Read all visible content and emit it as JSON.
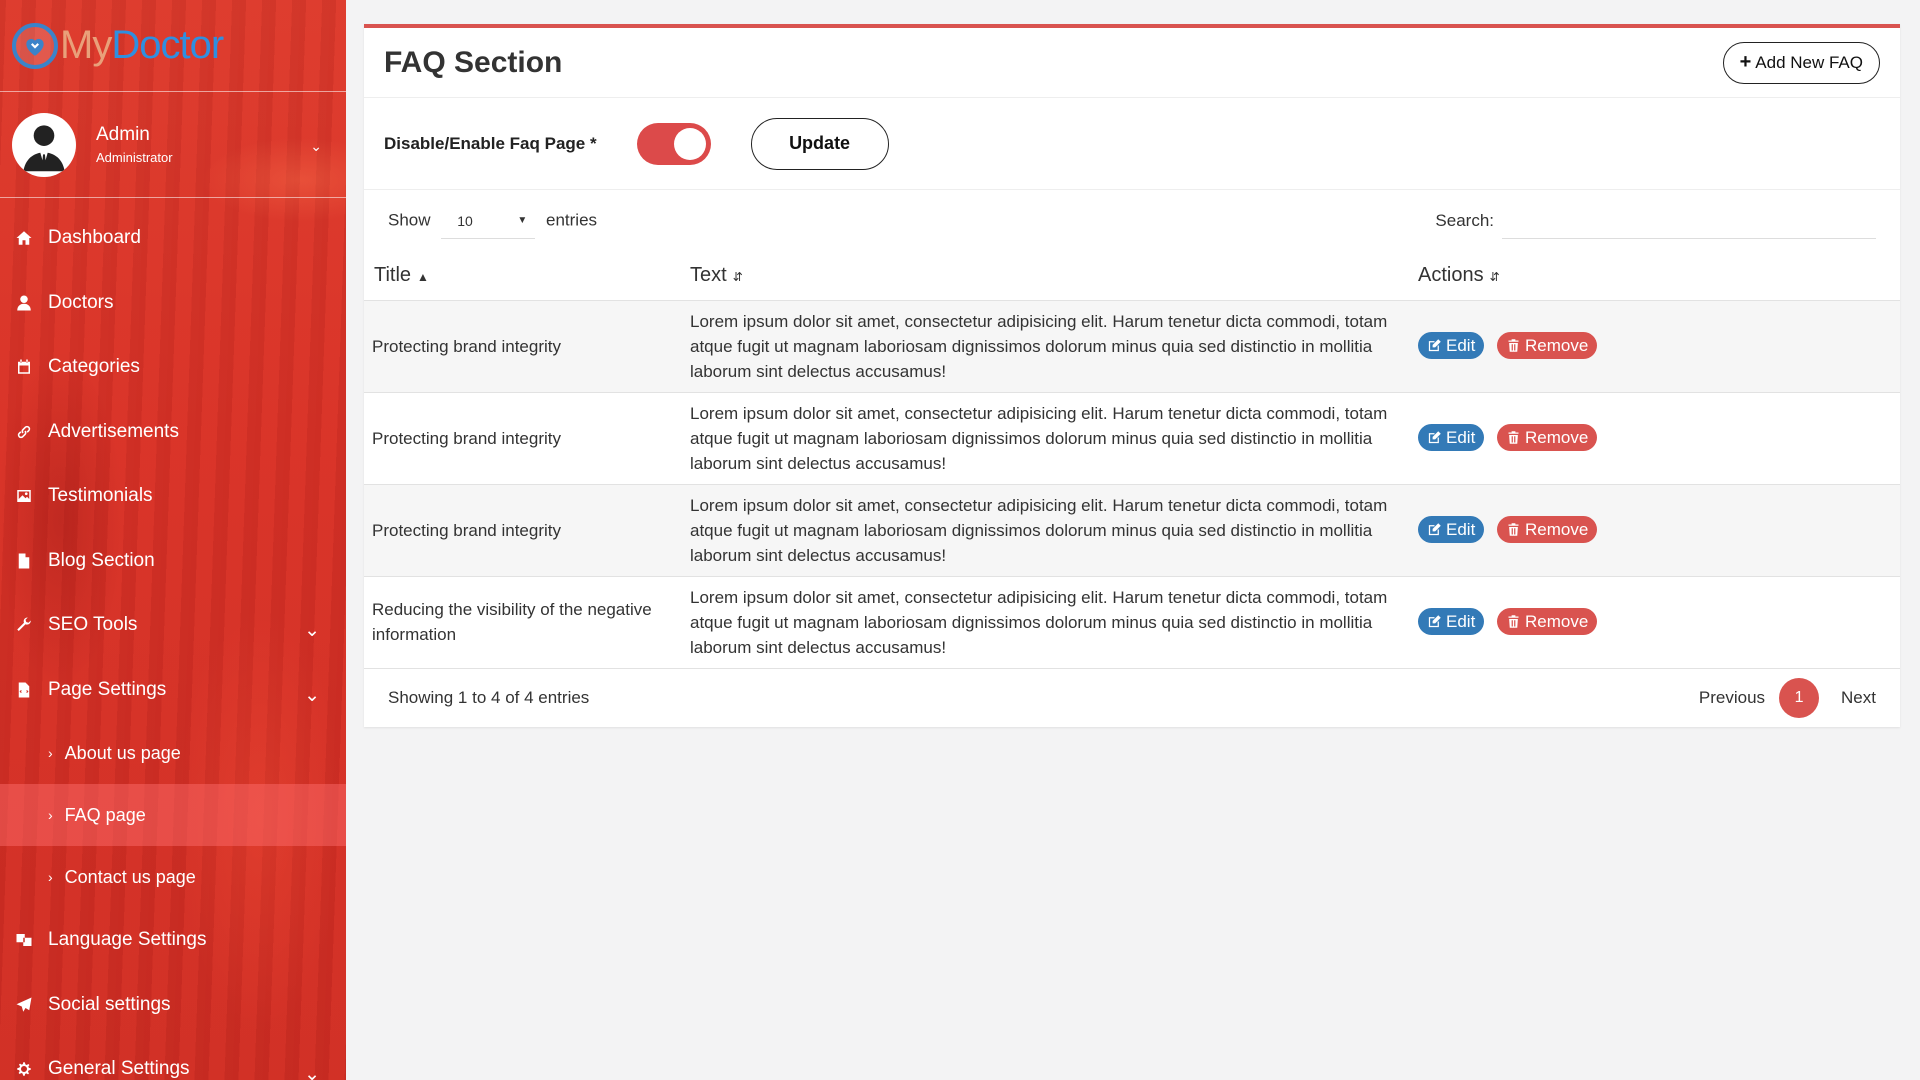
{
  "brand": {
    "logo_part1": "My",
    "logo_part2": "Doctor"
  },
  "profile": {
    "name": "Admin",
    "role": "Administrator"
  },
  "sidebar": {
    "items": [
      {
        "label": "Dashboard",
        "icon": "home-icon"
      },
      {
        "label": "Doctors",
        "icon": "user-md-icon"
      },
      {
        "label": "Categories",
        "icon": "calendar-icon"
      },
      {
        "label": "Advertisements",
        "icon": "link-icon"
      },
      {
        "label": "Testimonials",
        "icon": "image-icon"
      },
      {
        "label": "Blog Section",
        "icon": "file-icon"
      },
      {
        "label": "SEO Tools",
        "icon": "wrench-icon",
        "has_children": true
      },
      {
        "label": "Page Settings",
        "icon": "file-code-icon",
        "has_children": true,
        "expanded": true
      },
      {
        "label": "Language Settings",
        "icon": "language-icon"
      },
      {
        "label": "Social settings",
        "icon": "paper-plane-icon"
      },
      {
        "label": "General Settings",
        "icon": "cogs-icon",
        "has_children": true
      }
    ],
    "page_settings_children": [
      {
        "label": "About us page",
        "active": false
      },
      {
        "label": "FAQ page",
        "active": true
      },
      {
        "label": "Contact us page",
        "active": false
      }
    ]
  },
  "header": {
    "title": "FAQ Section",
    "add_button": "Add New FAQ"
  },
  "toggle": {
    "label": "Disable/Enable Faq Page *",
    "enabled": true,
    "update_button": "Update"
  },
  "controls": {
    "show_label": "Show",
    "entries_value": "10",
    "entries_label": "entries",
    "search_label": "Search:",
    "search_value": ""
  },
  "table": {
    "columns": [
      "Title",
      "Text",
      "Actions"
    ],
    "rows": [
      {
        "title": "Protecting brand integrity",
        "text": "Lorem ipsum dolor sit amet, consectetur adipisicing elit. Harum tenetur dicta commodi, totam atque fugit ut magnam laboriosam dignissimos dolorum minus quia sed distinctio in mollitia laborum sint delectus accusamus!"
      },
      {
        "title": "Protecting brand integrity",
        "text": "Lorem ipsum dolor sit amet, consectetur adipisicing elit. Harum tenetur dicta commodi, totam atque fugit ut magnam laboriosam dignissimos dolorum minus quia sed distinctio in mollitia laborum sint delectus accusamus!"
      },
      {
        "title": "Protecting brand integrity",
        "text": "Lorem ipsum dolor sit amet, consectetur adipisicing elit. Harum tenetur dicta commodi, totam atque fugit ut magnam laboriosam dignissimos dolorum minus quia sed distinctio in mollitia laborum sint delectus accusamus!"
      },
      {
        "title": "Reducing the visibility of the negative information",
        "text": "Lorem ipsum dolor sit amet, consectetur adipisicing elit. Harum tenetur dicta commodi, totam atque fugit ut magnam laboriosam dignissimos dolorum minus quia sed distinctio in mollitia laborum sint delectus accusamus!"
      }
    ],
    "edit_label": "Edit",
    "remove_label": "Remove"
  },
  "footer": {
    "info": "Showing 1 to 4 of 4 entries",
    "previous": "Previous",
    "current_page": "1",
    "next": "Next"
  },
  "colors": {
    "accent": "#d9534f",
    "edit_blue": "#337ab7",
    "sidebar_red": "#d83328"
  }
}
